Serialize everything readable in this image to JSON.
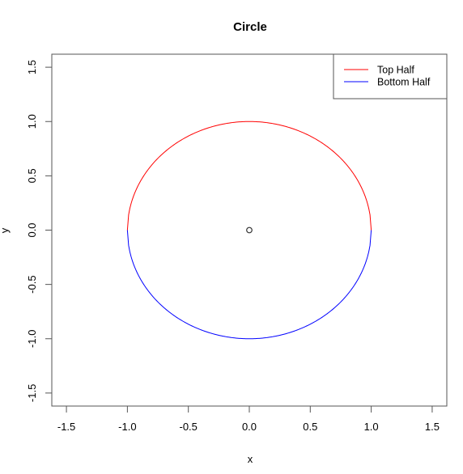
{
  "chart_data": {
    "type": "line",
    "title": "Circle",
    "xlabel": "x",
    "ylabel": "y",
    "xlim": [
      -1.62,
      1.62
    ],
    "ylim": [
      -1.62,
      1.62
    ],
    "xticks": [
      -1.5,
      -1.0,
      -0.5,
      0.0,
      0.5,
      1.0,
      1.5
    ],
    "yticks": [
      -1.5,
      -1.0,
      -0.5,
      0.0,
      0.5,
      1.0,
      1.5
    ],
    "xtick_labels": [
      "-1.5",
      "-1.0",
      "-0.5",
      "0.0",
      "0.5",
      "1.0",
      "1.5"
    ],
    "ytick_labels": [
      "-1.5",
      "-1.0",
      "-0.5",
      "0.0",
      "0.5",
      "1.0",
      "1.5"
    ],
    "grid": false,
    "legend_position": "top-right",
    "series": [
      {
        "name": "Top Half",
        "color": "#ff0000",
        "equation": "y = sqrt(1 - x^2)",
        "x_range": [
          -1,
          1
        ],
        "radius": 1
      },
      {
        "name": "Bottom Half",
        "color": "#0000ff",
        "equation": "y = -sqrt(1 - x^2)",
        "x_range": [
          -1,
          1
        ],
        "radius": 1
      }
    ],
    "points": [
      {
        "label": "center",
        "x": 0,
        "y": 0,
        "marker": "open-circle"
      }
    ]
  }
}
